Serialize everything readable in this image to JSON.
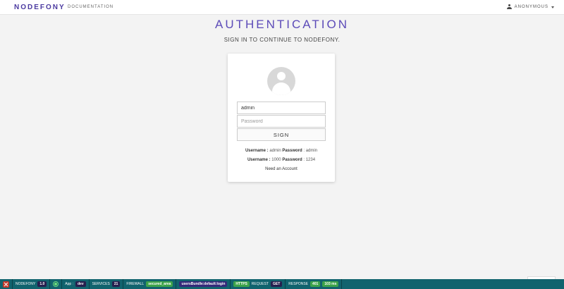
{
  "navbar": {
    "brand": "NODEFONY",
    "documentation": "DOCUMENTATION",
    "user": "ANONYMOUS"
  },
  "page": {
    "title": "AUTHENTICATION",
    "subtitle": "SIGN IN TO CONTINUE TO NODEFONY."
  },
  "form": {
    "username_value": "admin",
    "password_placeholder": "Password",
    "sign_label": "SIGN",
    "hint1_username_label": "Username :",
    "hint1_username_value": "admin",
    "hint1_password_label": "Password",
    "hint1_password_value": ": admin",
    "hint2_username_label": "Username :",
    "hint2_username_value": "1000",
    "hint2_password_label": "Password",
    "hint2_password_value": ": 1234",
    "need_account": "Need an Account"
  },
  "debugbar": {
    "name": "NODEFONY",
    "version": "1.0",
    "app_label": "App :",
    "app_value": "dev",
    "services_label": "SERVICES",
    "services_value": "21",
    "firewall_label": "FIREWALL",
    "firewall_value": "secured_area",
    "route": "usersBundle:default:login",
    "https": "HTTPS",
    "request_label": "REQUEST",
    "request_value": "GET",
    "response_label": "RESPONSE",
    "response_value": "401",
    "time_value": "103 ms"
  },
  "colors": {
    "brand": "#4b3aa0",
    "title": "#5c4bb8",
    "debugbar": "#11636e"
  }
}
